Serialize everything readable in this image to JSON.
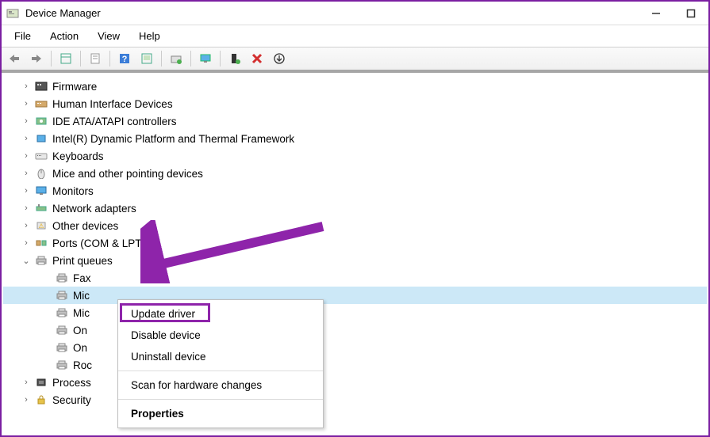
{
  "title": "Device Manager",
  "menubar": [
    "File",
    "Action",
    "View",
    "Help"
  ],
  "tree": [
    {
      "label": "Firmware",
      "icon": "firmware",
      "level": 1,
      "expander": "›"
    },
    {
      "label": "Human Interface Devices",
      "icon": "hid",
      "level": 1,
      "expander": "›"
    },
    {
      "label": "IDE ATA/ATAPI controllers",
      "icon": "ide",
      "level": 1,
      "expander": "›"
    },
    {
      "label": "Intel(R) Dynamic Platform and Thermal Framework",
      "icon": "intel",
      "level": 1,
      "expander": "›"
    },
    {
      "label": "Keyboards",
      "icon": "keyboard",
      "level": 1,
      "expander": "›"
    },
    {
      "label": "Mice and other pointing devices",
      "icon": "mouse",
      "level": 1,
      "expander": "›"
    },
    {
      "label": "Monitors",
      "icon": "monitor",
      "level": 1,
      "expander": "›"
    },
    {
      "label": "Network adapters",
      "icon": "network",
      "level": 1,
      "expander": "›"
    },
    {
      "label": "Other devices",
      "icon": "other",
      "level": 1,
      "expander": "›"
    },
    {
      "label": "Ports (COM & LPT)",
      "icon": "ports",
      "level": 1,
      "expander": "›"
    },
    {
      "label": "Print queues",
      "icon": "printer",
      "level": 1,
      "expander": "⌄"
    },
    {
      "label": "Fax",
      "icon": "printer",
      "level": 2,
      "expander": ""
    },
    {
      "label": "Mic",
      "icon": "printer",
      "level": 2,
      "expander": "",
      "selected": true
    },
    {
      "label": "Mic",
      "icon": "printer",
      "level": 2,
      "expander": ""
    },
    {
      "label": "On",
      "icon": "printer",
      "level": 2,
      "expander": ""
    },
    {
      "label": "On",
      "icon": "printer",
      "level": 2,
      "expander": ""
    },
    {
      "label": "Roc",
      "icon": "printer",
      "level": 2,
      "expander": ""
    },
    {
      "label": "Process",
      "icon": "processor",
      "level": 1,
      "expander": "›"
    },
    {
      "label": "Security",
      "icon": "security",
      "level": 1,
      "expander": "›"
    }
  ],
  "context_menu": [
    {
      "label": "Update driver",
      "bold": false
    },
    {
      "label": "Disable device",
      "bold": false
    },
    {
      "label": "Uninstall device",
      "bold": false
    },
    {
      "sep": true
    },
    {
      "label": "Scan for hardware changes",
      "bold": false
    },
    {
      "sep": true
    },
    {
      "label": "Properties",
      "bold": true
    }
  ]
}
